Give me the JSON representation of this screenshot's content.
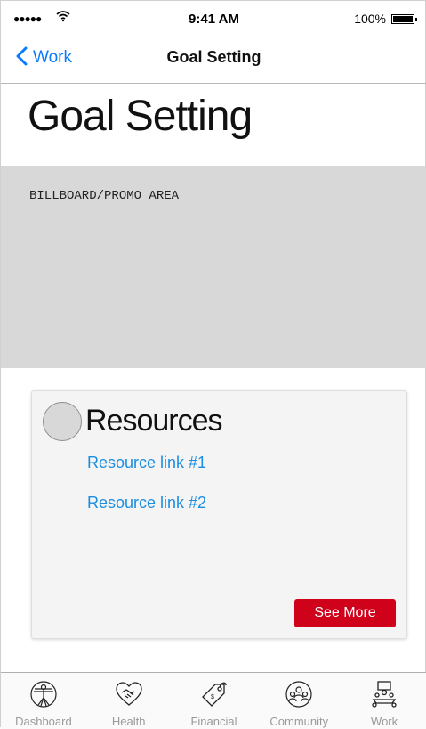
{
  "status_bar": {
    "signal": "●●●●●",
    "time": "9:41 AM",
    "battery_percent": "100%"
  },
  "nav": {
    "back_label": "Work",
    "title": "Goal Setting"
  },
  "page": {
    "title": "Goal Setting"
  },
  "billboard": {
    "label": "BILLBOARD/PROMO AREA"
  },
  "resources": {
    "title": "Resources",
    "links": [
      "Resource link #1",
      "Resource link #2"
    ],
    "see_more_label": "See More",
    "button_color": "#d0021b"
  },
  "tabs": [
    {
      "label": "Dashboard",
      "icon": "vitruvian-man-icon"
    },
    {
      "label": "Health",
      "icon": "heart-handshake-icon"
    },
    {
      "label": "Financial",
      "icon": "price-tag-icon"
    },
    {
      "label": "Community",
      "icon": "community-group-icon"
    },
    {
      "label": "Work",
      "icon": "meeting-table-icon"
    }
  ],
  "colors": {
    "accent": "#0a7bff",
    "link": "#1b8ee0",
    "billboard_bg": "#d8d8d8"
  }
}
